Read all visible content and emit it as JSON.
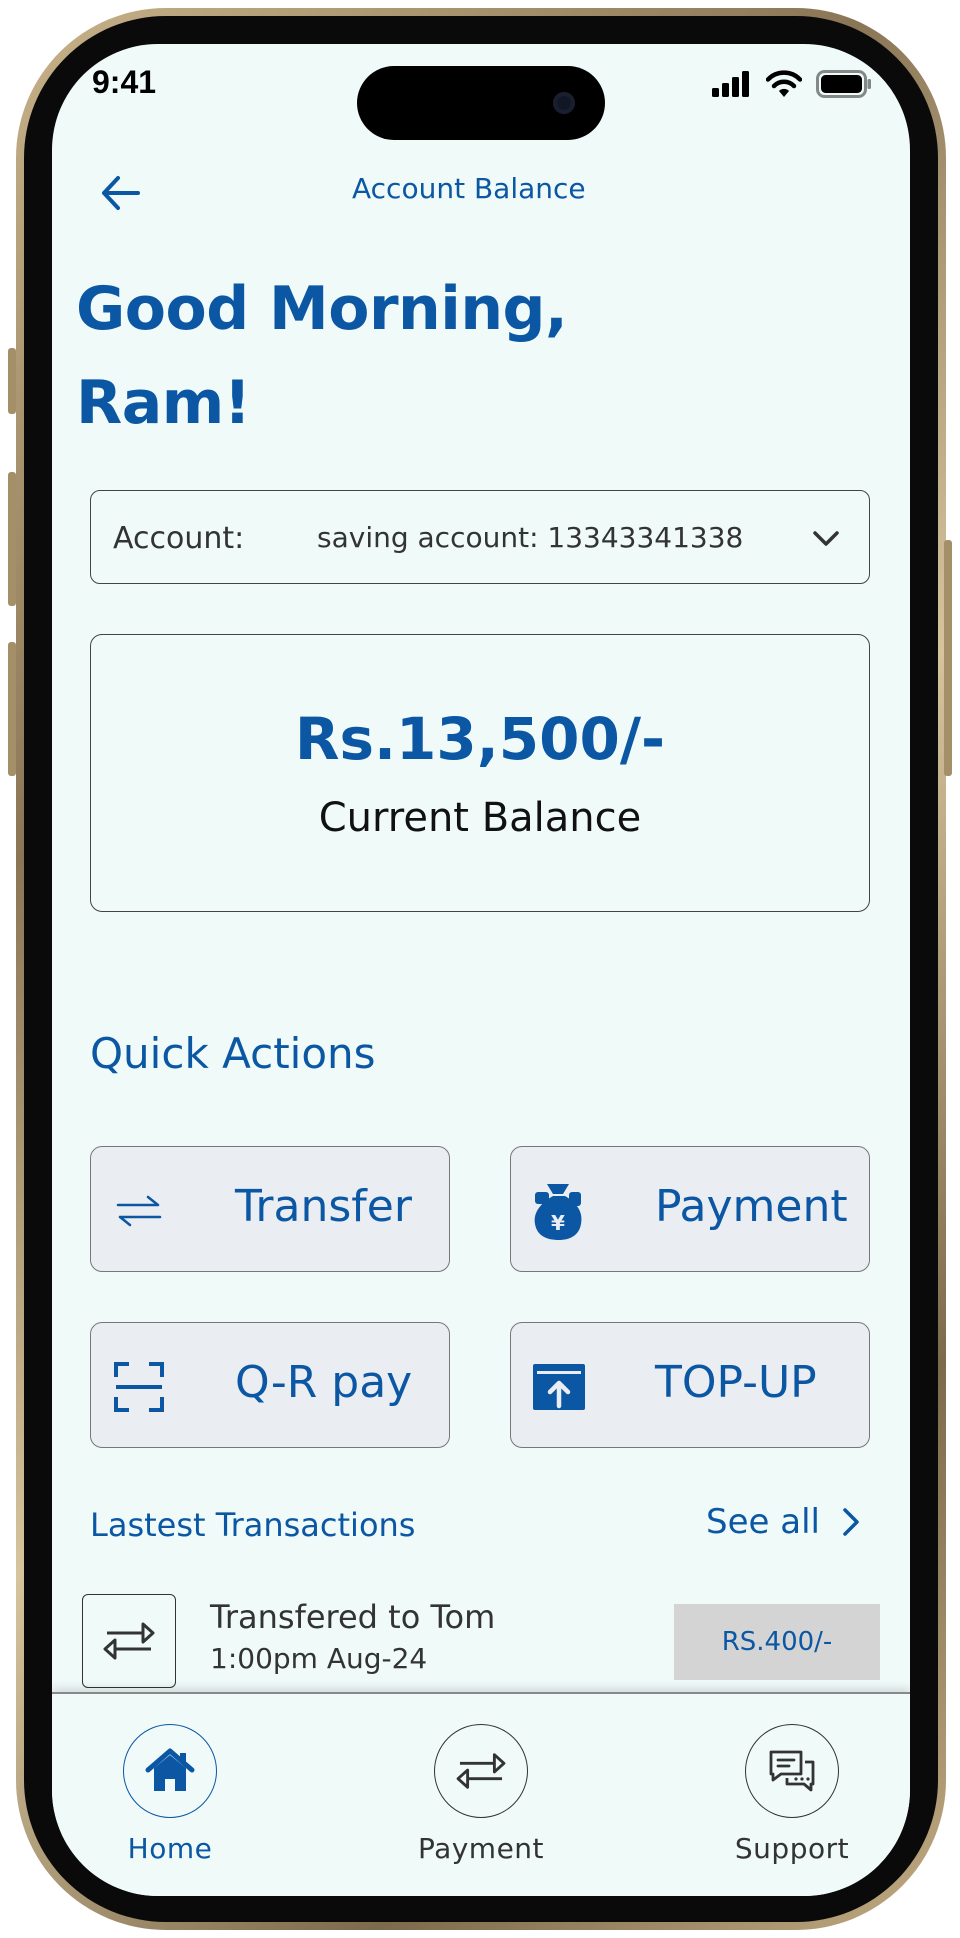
{
  "status_bar": {
    "time": "9:41"
  },
  "header": {
    "title": "Account Balance"
  },
  "greeting": {
    "line1": "Good Morning,",
    "line2": "Ram!"
  },
  "account": {
    "label": "Account:",
    "value": "saving account: 13343341338"
  },
  "balance": {
    "amount": "Rs.13,500/-",
    "label": "Current Balance"
  },
  "quick_actions": {
    "title": "Quick Actions",
    "items": [
      {
        "label": "Transfer",
        "icon": "transfer-arrows-icon"
      },
      {
        "label": "Payment",
        "icon": "money-bag-icon"
      },
      {
        "label": "Q-R pay",
        "icon": "qr-scan-icon"
      },
      {
        "label": "TOP-UP",
        "icon": "top-up-icon"
      }
    ]
  },
  "transactions": {
    "title": "Lastest Transactions",
    "see_all": "See all",
    "items": [
      {
        "name": "Transfered to Tom",
        "time": "1:00pm Aug-24",
        "amount": "RS.400/-"
      }
    ]
  },
  "nav": {
    "items": [
      {
        "label": "Home",
        "icon": "home-icon",
        "active": true
      },
      {
        "label": "Payment",
        "icon": "transfer-arrows-icon",
        "active": false
      },
      {
        "label": "Support",
        "icon": "chat-support-icon",
        "active": false
      }
    ]
  },
  "colors": {
    "accent": "#0b57a4",
    "background": "#effaf9",
    "card": "#eaedf2"
  }
}
